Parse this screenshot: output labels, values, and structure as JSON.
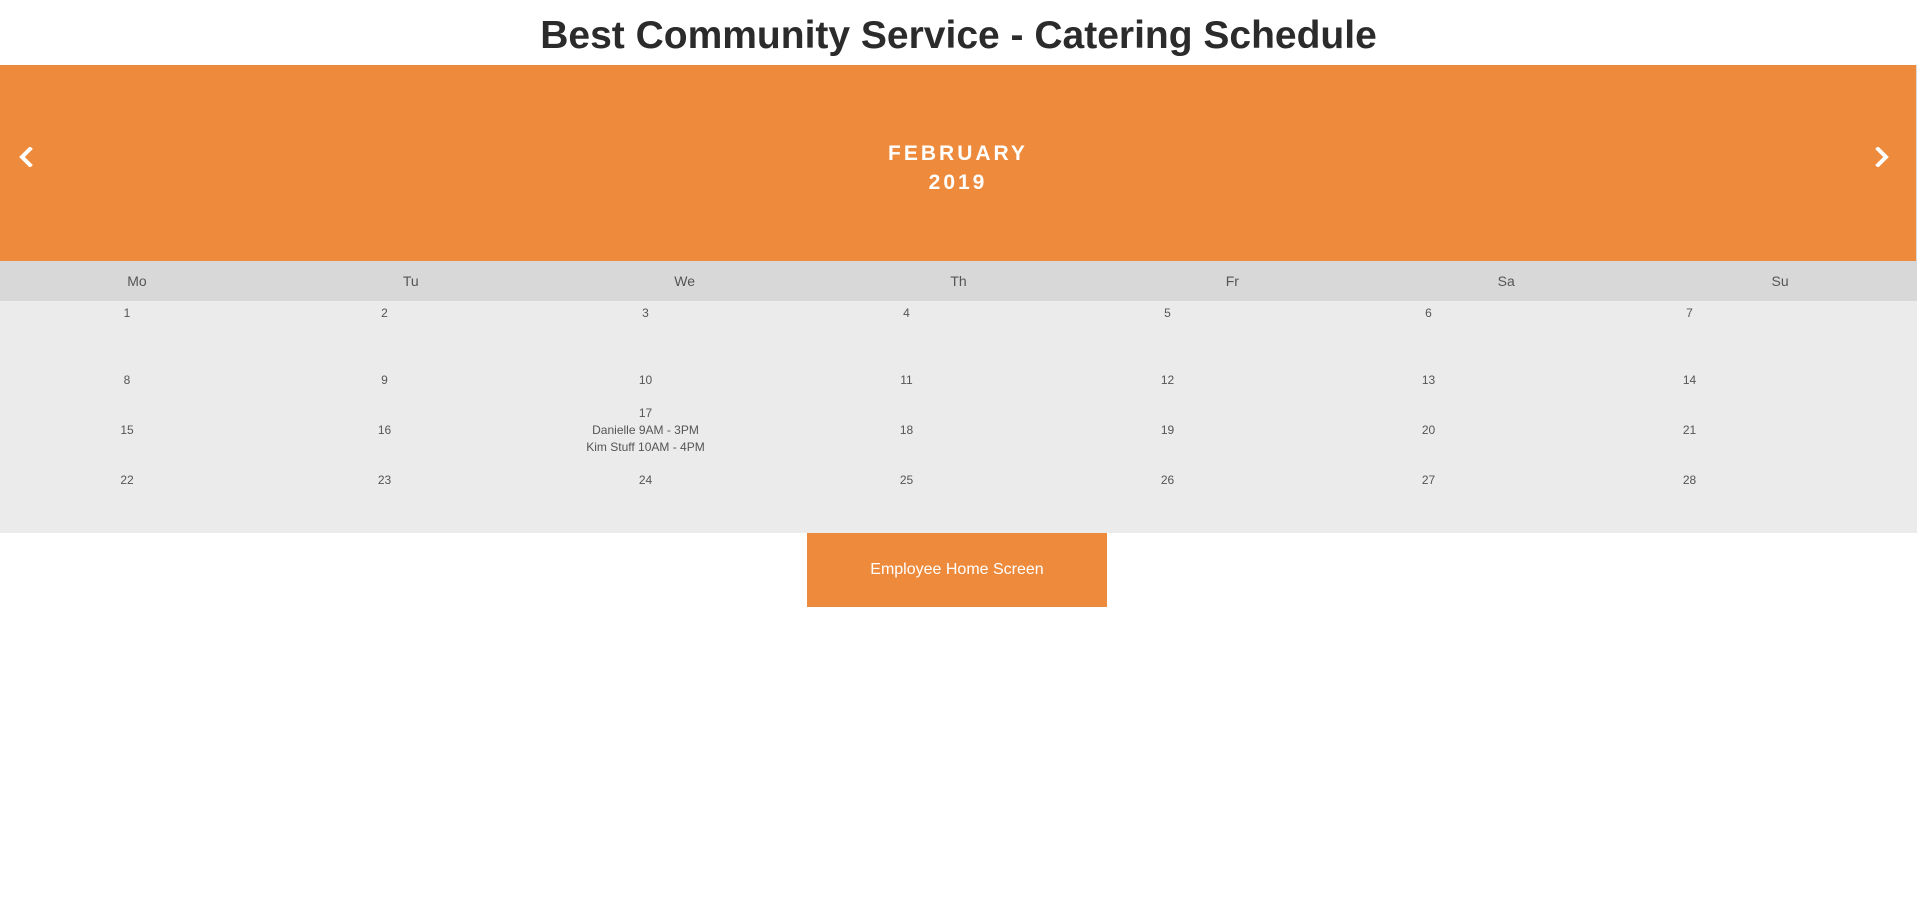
{
  "page": {
    "title": "Best Community Service - Catering Schedule"
  },
  "calendar": {
    "month": "FEBRUARY",
    "year": "2019",
    "prev_glyph": "‹",
    "next_glyph": "›",
    "weekdays": [
      "Mo",
      "Tu",
      "We",
      "Th",
      "Fr",
      "Sa",
      "Su"
    ],
    "weeks": [
      [
        {
          "day": "1"
        },
        {
          "day": "2"
        },
        {
          "day": "3"
        },
        {
          "day": "4"
        },
        {
          "day": "5"
        },
        {
          "day": "6"
        },
        {
          "day": "7"
        }
      ],
      [
        {
          "day": "8"
        },
        {
          "day": "9"
        },
        {
          "day": "10"
        },
        {
          "day": "11"
        },
        {
          "day": "12"
        },
        {
          "day": "13"
        },
        {
          "day": "14"
        }
      ],
      [
        {
          "day": "15"
        },
        {
          "day": "16"
        },
        {
          "day": "17",
          "events": [
            "Danielle 9AM - 3PM",
            "Kim Stuff 10AM - 4PM"
          ]
        },
        {
          "day": "18"
        },
        {
          "day": "19"
        },
        {
          "day": "20"
        },
        {
          "day": "21"
        }
      ],
      [
        {
          "day": "22"
        },
        {
          "day": "23"
        },
        {
          "day": "24"
        },
        {
          "day": "25"
        },
        {
          "day": "26"
        },
        {
          "day": "27"
        },
        {
          "day": "28"
        }
      ]
    ]
  },
  "footer": {
    "home_button_label": "Employee Home Screen"
  },
  "colors": {
    "accent": "#ee8a3c",
    "weekday_bar": "#d8d8d8",
    "grid_background": "#ebebeb",
    "title_text": "#2b2b2b"
  },
  "icons": {
    "prev": "chevron-left-icon",
    "next": "chevron-right-icon"
  }
}
